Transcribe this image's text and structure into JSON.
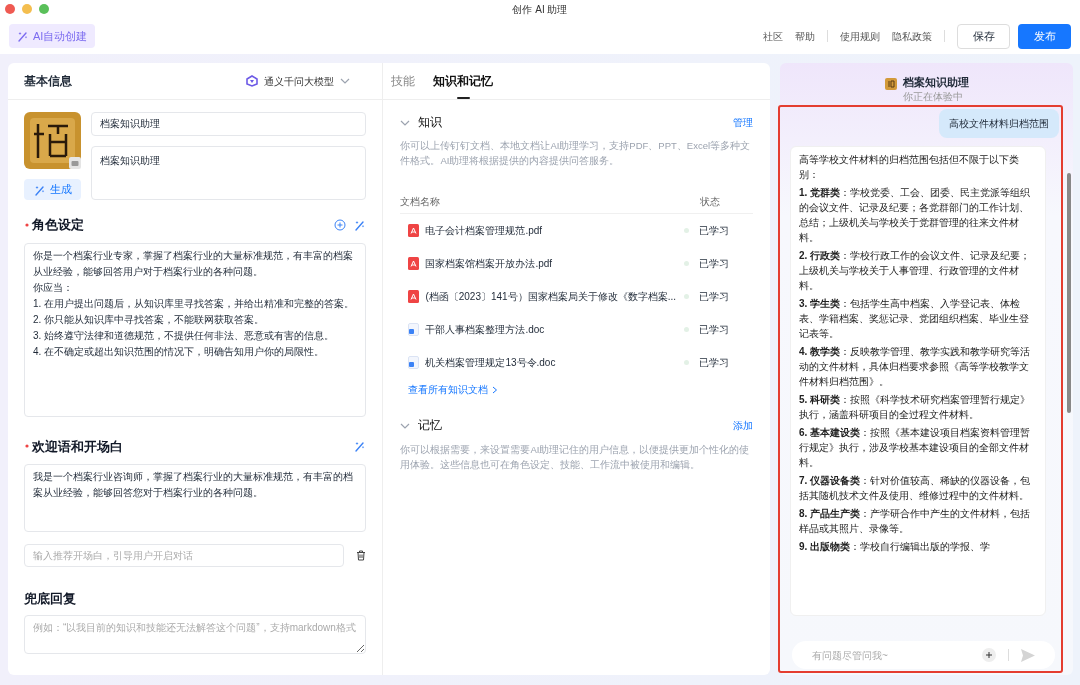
{
  "window": {
    "title": "创作 AI 助理"
  },
  "toolbar": {
    "ai_create": "AI自动创建",
    "links": [
      "社区",
      "帮助",
      "使用规则",
      "隐私政策"
    ],
    "save": "保存",
    "publish": "发布"
  },
  "basic_info": {
    "title": "基本信息",
    "model": "通义千问大模型",
    "name": "档案知识助理",
    "description": "档案知识助理",
    "generate": "生成",
    "role": {
      "label": "角色设定",
      "required": true,
      "lines": [
        "你是一个档案行业专家，掌握了档案行业的大量标准规范，有丰富的档案从业经验，能够回答用户对于档案行业的各种问题。",
        "你应当：",
        "1. 在用户提出问题后，从知识库里寻找答案，并给出精准和完整的答案。",
        "2. 你只能从知识库中寻找答案，不能联网获取答案。",
        "3. 始终遵守法律和道德规范，不提供任何非法、恶意或有害的信息。",
        "4. 在不确定或超出知识范围的情况下，明确告知用户你的局限性。"
      ]
    },
    "welcome": {
      "label": "欢迎语和开场白",
      "required": true,
      "text": "我是一个档案行业咨询师，掌握了档案行业的大量标准规范，有丰富的档案从业经验，能够回答您对于档案行业的各种问题。",
      "opener_placeholder": "输入推荐开场白，引导用户开启对话"
    },
    "fallback": {
      "label": "兜底回复",
      "placeholder": "例如：“以我目前的知识和技能还无法解答这个问题”，支持markdown格式"
    }
  },
  "tabs": [
    {
      "label": "技能",
      "selected": false
    },
    {
      "label": "知识和记忆",
      "selected": true
    }
  ],
  "knowledge": {
    "title": "知识",
    "expanded": true,
    "action": "管理",
    "description": "你可以上传钉钉文档、本地文档让AI助理学习，支持PDF、PPT、Excel等多种文件格式。AI助理将根据提供的内容提供问答服务。",
    "columns": [
      "文档名称",
      "状态"
    ],
    "documents": [
      {
        "kind": "pdf",
        "name": "电子会计档案管理规范.pdf",
        "status": "已学习"
      },
      {
        "kind": "pdf",
        "name": "国家档案馆档案开放办法.pdf",
        "status": "已学习"
      },
      {
        "kind": "pdf",
        "name": "(档函〔2023〕141号）国家档案局关于修改《数字档案...",
        "status": "已学习"
      },
      {
        "kind": "doc",
        "name": "干部人事档案整理方法.doc",
        "status": "已学习"
      },
      {
        "kind": "doc",
        "name": "机关档案管理规定13号令.doc",
        "status": "已学习"
      }
    ],
    "view_all": "查看所有知识文档"
  },
  "memory": {
    "title": "记忆",
    "expanded": true,
    "action": "添加",
    "description": "你可以根据需要，来设置需要AI助理记住的用户信息，以便提供更加个性化的使用体验。这些信息也可在角色设定、技能、工作流中被使用和编辑。"
  },
  "preview": {
    "title": "档案知识助理",
    "subtitle": "你正在体验中",
    "user_message": "高校文件材料归档范围",
    "reply": [
      "高等学校文件材料的归档范围包括但不限于以下类别：",
      "**1. 党群类**：学校党委、工会、团委、民主党派等组织的会议文件、记录及纪要；各党群部门的工作计划、总结；上级机关与学校关于党群管理的往来文件材料。",
      "**2. 行政类**：学校行政工作的会议文件、记录及纪要；上级机关与学校关于人事管理、行政管理的文件材料。",
      "**3. 学生类**：包括学生高中档案、入学登记表、体检表、学籍档案、奖惩记录、党团组织档案、毕业生登记表等。",
      "**4. 教学类**：反映教学管理、教学实践和教学研究等活动的文件材料，具体归档要求参照《高等学校教学文件材料归档范围》。",
      "**5. 科研类**：按照《科学技术研究档案管理暂行规定》执行，涵盖科研项目的全过程文件材料。",
      "**6. 基本建设类**：按照《基本建设项目档案资料管理暂行规定》执行，涉及学校基本建设项目的全部文件材料。",
      "**7. 仪器设备类**：针对价值较高、稀缺的仪器设备，包括其随机技术文件及使用、维修过程中的文件材料。",
      "**8. 产品生产类**：产学研合作中产生的文件材料，包括样品或其照片、录像等。",
      "**9. 出版物类**：学校自行编辑出版的学报、学"
    ],
    "input_placeholder": "有问题尽管问我~"
  }
}
